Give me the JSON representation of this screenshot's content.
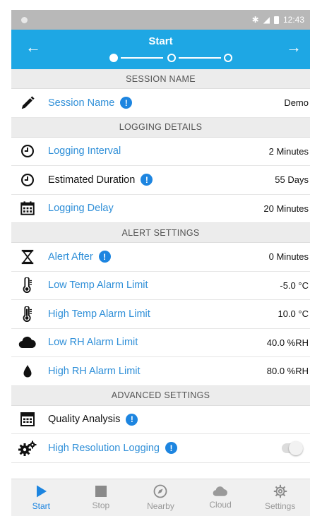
{
  "statusbar": {
    "time": "12:43"
  },
  "appbar": {
    "title": "Start",
    "back_icon": "arrow-left-icon",
    "forward_icon": "arrow-right-icon",
    "step_current": 1,
    "step_total": 3
  },
  "sections": {
    "session_name": "SESSION NAME",
    "logging_details": "LOGGING DETAILS",
    "alert_settings": "ALERT SETTINGS",
    "advanced_settings": "ADVANCED SETTINGS"
  },
  "rows": {
    "session_name": {
      "label": "Session Name",
      "value": "Demo"
    },
    "logging_interval": {
      "label": "Logging Interval",
      "value": "2 Minutes"
    },
    "estimated_duration": {
      "label": "Estimated Duration",
      "value": "55 Days"
    },
    "logging_delay": {
      "label": "Logging Delay",
      "value": "20 Minutes"
    },
    "alert_after": {
      "label": "Alert After",
      "value": "0 Minutes"
    },
    "low_temp": {
      "label": "Low Temp Alarm Limit",
      "value": "-5.0 °C"
    },
    "high_temp": {
      "label": "High Temp Alarm Limit",
      "value": "10.0 °C"
    },
    "low_rh": {
      "label": "Low RH Alarm Limit",
      "value": "40.0 %RH"
    },
    "high_rh": {
      "label": "High RH Alarm Limit",
      "value": "80.0 %RH"
    },
    "quality_analysis": {
      "label": "Quality Analysis"
    },
    "high_res_logging": {
      "label": "High Resolution Logging",
      "enabled": false
    }
  },
  "info_glyph": "!",
  "tabs": [
    {
      "label": "Start",
      "icon": "play-icon"
    },
    {
      "label": "Stop",
      "icon": "stop-icon"
    },
    {
      "label": "Nearby",
      "icon": "compass-icon"
    },
    {
      "label": "Cloud",
      "icon": "cloud-icon"
    },
    {
      "label": "Settings",
      "icon": "gear-icon"
    }
  ],
  "colors": {
    "accent": "#1ea7e4",
    "link": "#2f8fd8",
    "info": "#1d85e0"
  }
}
